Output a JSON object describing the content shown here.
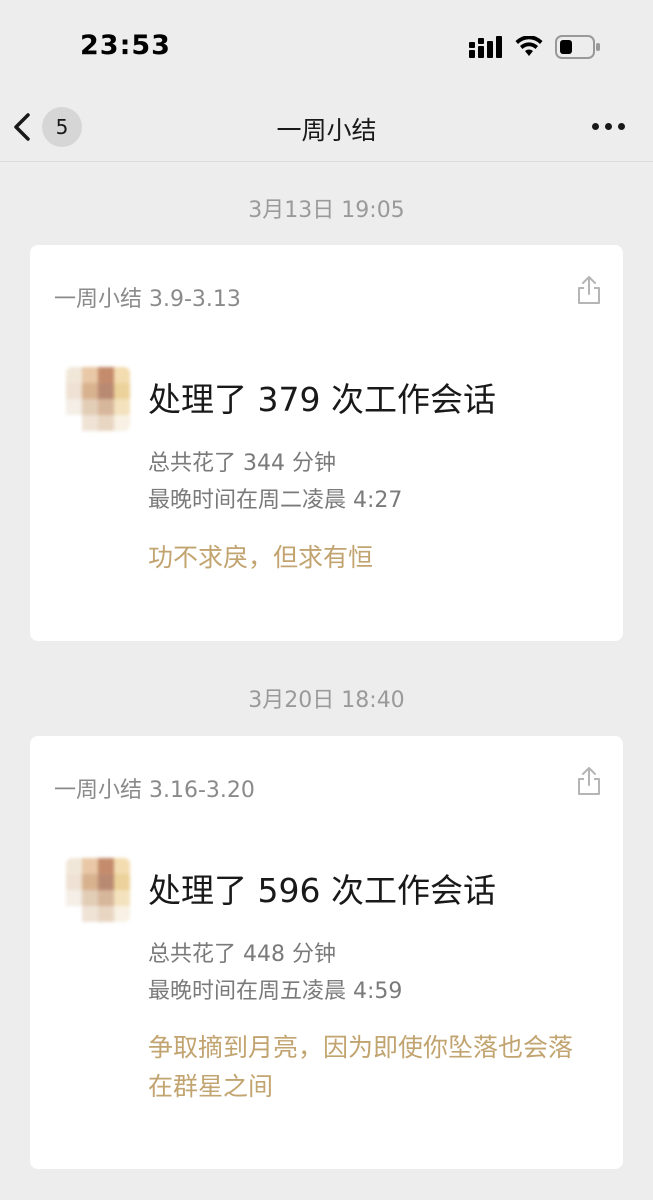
{
  "status_bar": {
    "time": "23:53",
    "icons": [
      "signal-icon",
      "wifi-icon",
      "battery-icon"
    ]
  },
  "nav": {
    "badge_count": "5",
    "title": "一周小结",
    "icons": [
      "back-chevron-icon",
      "more-dots-icon"
    ]
  },
  "summaries": [
    {
      "timestamp": "3月13日 19:05",
      "header": "一周小结 3.9-3.13",
      "headline": "处理了 379 次工作会话",
      "total_time": "总共花了 344 分钟",
      "latest_time": "最晚时间在周二凌晨 4:27",
      "motto": "功不求戾，但求有恒"
    },
    {
      "timestamp": "3月20日 18:40",
      "header": "一周小结 3.16-3.20",
      "headline": "处理了 596 次工作会话",
      "total_time": "总共花了 448 分钟",
      "latest_time": "最晚时间在周五凌晨 4:59",
      "motto": "争取摘到月亮，因为即使你坠落也会落在群星之间"
    }
  ],
  "colors": {
    "background": "#ededed",
    "card": "#ffffff",
    "motto_accent": "#c2a470",
    "secondary_text": "#7a7a7a"
  }
}
